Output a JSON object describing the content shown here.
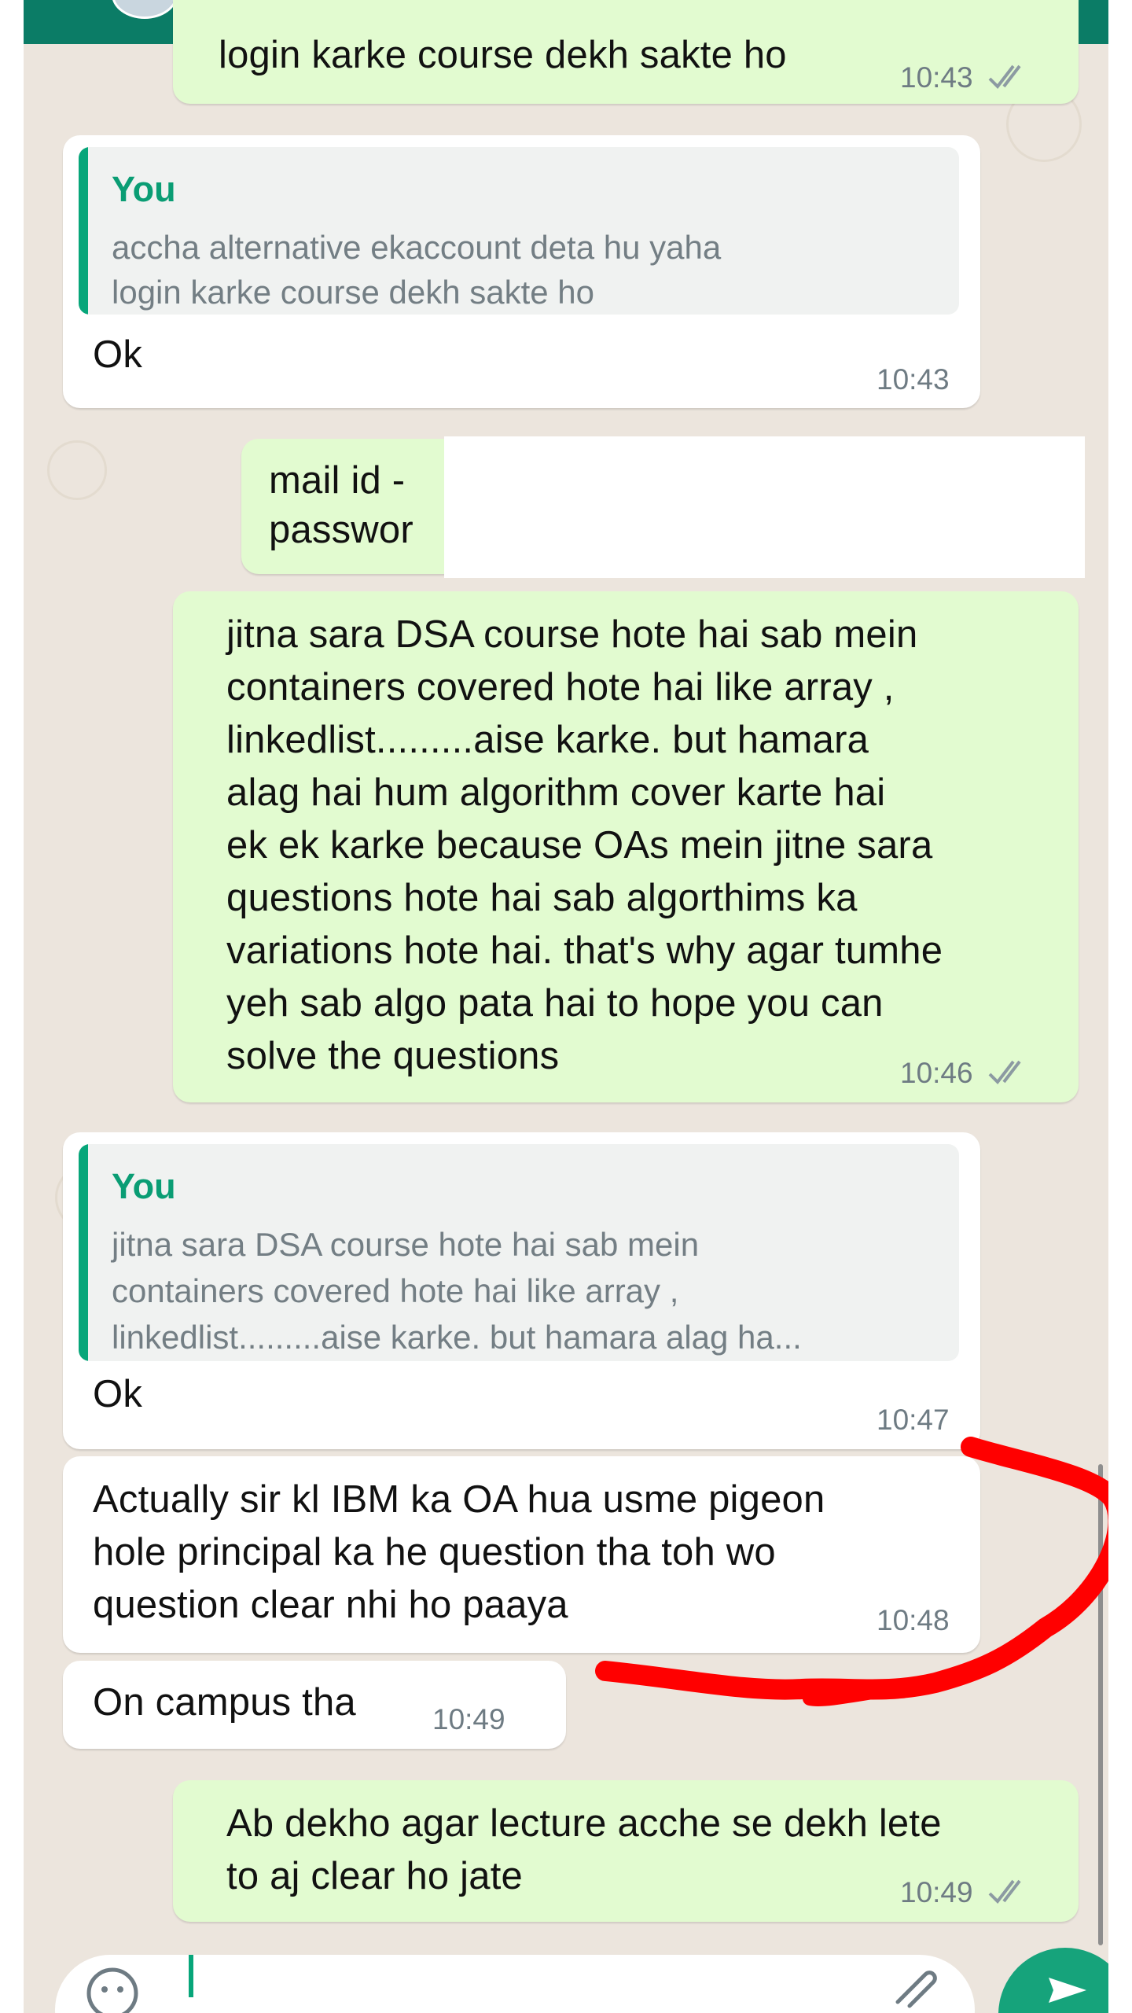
{
  "header": {
    "avatar": "contact-avatar"
  },
  "messages": {
    "m1": {
      "text": "login karke course dekh sakte ho",
      "time": "10:43",
      "status": "read"
    },
    "m2": {
      "quote": {
        "author": "You",
        "line1": "accha alternative ekaccount deta hu yaha",
        "line2": "login karke course dekh sakte ho"
      },
      "text": "Ok",
      "time": "10:43"
    },
    "m3": {
      "line1": "mail id - ",
      "line2": "passwor"
    },
    "m4": {
      "lines": [
        "jitna sara DSA course hote hai sab mein",
        "containers covered hote hai like array ,",
        "linkedlist.........aise karke. but hamara",
        "alag hai hum algorithm cover karte hai",
        "ek ek karke because OAs mein jitne sara",
        "questions hote hai sab algorthims ka",
        "variations hote hai. that's why agar tumhe",
        "yeh sab algo pata hai to hope you can",
        "solve the questions"
      ],
      "time": "10:46",
      "status": "read"
    },
    "m5": {
      "quote": {
        "author": "You",
        "line1": "jitna sara DSA course hote hai sab mein",
        "line2": "containers covered hote hai like array ,",
        "line3": "linkedlist.........aise karke. but hamara alag ha..."
      },
      "text": "Ok",
      "time": "10:47"
    },
    "m6": {
      "lines": [
        "Actually sir kl IBM ka OA hua usme pigeon",
        "hole principal ka he question tha toh wo",
        "question clear nhi ho paaya"
      ],
      "time": "10:48"
    },
    "m7": {
      "text": "On campus tha",
      "time": "10:49"
    },
    "m8": {
      "lines": [
        "Ab dekho agar lecture acche se dekh lete",
        "to aj clear ho jate"
      ],
      "time": "10:49",
      "status": "read"
    }
  },
  "composer": {
    "emoji_icon": "emoji-icon",
    "attach_icon": "attach-icon",
    "send_icon": "send-icon"
  },
  "colors": {
    "header": "#0b7c66",
    "wallpaper": "#ece5dd",
    "outgoing": "#e2fbd0",
    "incoming": "#ffffff",
    "annotation": "#ff0000",
    "tick": "#8c9aa2"
  }
}
